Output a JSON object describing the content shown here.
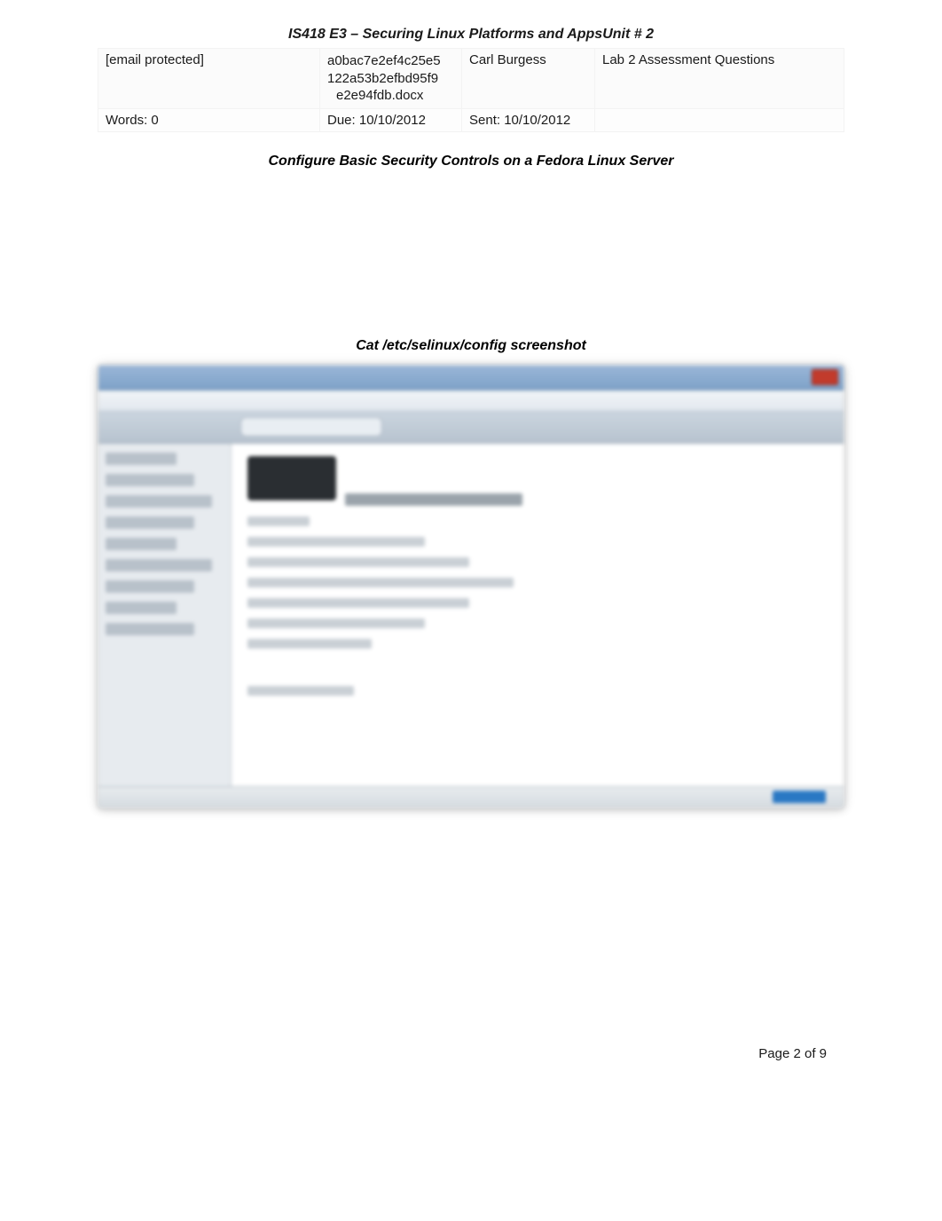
{
  "header": {
    "title": "IS418 E3 – Securing Linux Platforms and AppsUnit # 2"
  },
  "info": {
    "row1": {
      "email": "[email protected]",
      "filename_line1": "a0bac7e2ef4c25e5",
      "filename_line2": "122a53b2efbd95f9",
      "filename_line3": "e2e94fdb.docx",
      "author": "Carl Burgess",
      "assignment": "Lab 2 Assessment Questions"
    },
    "row2": {
      "words": "Words: 0",
      "due": "Due: 10/10/2012",
      "sent": "Sent: 10/10/2012",
      "blank": ""
    }
  },
  "subtitle": "Configure Basic Security Controls on a Fedora Linux Server",
  "screenshot_caption": "Cat /etc/selinux/config screenshot",
  "footer": {
    "page_label": "Page 2 of 9"
  }
}
